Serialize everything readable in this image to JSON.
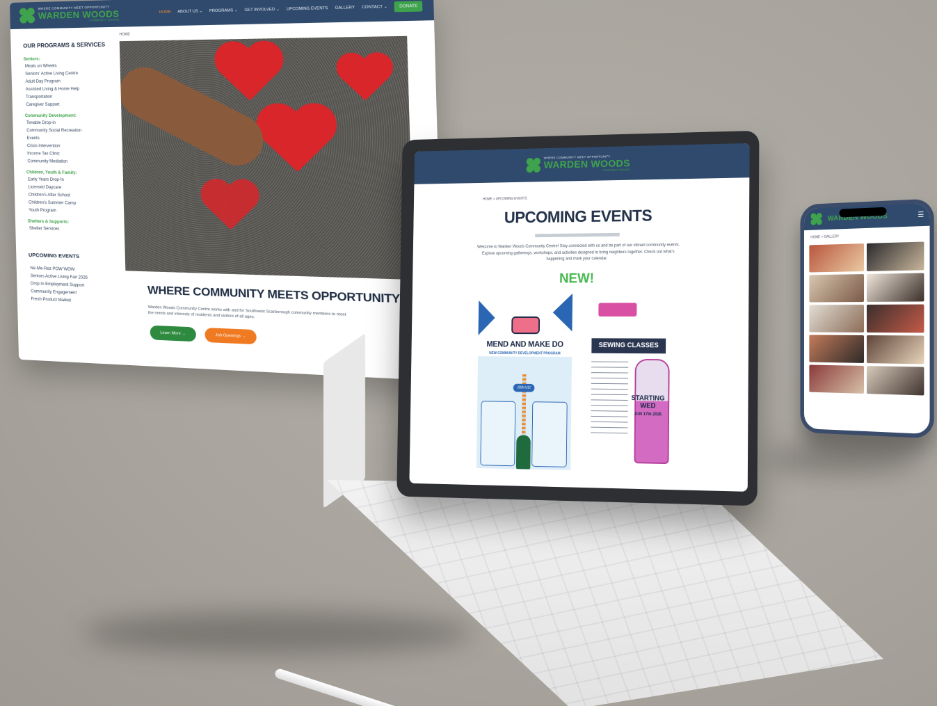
{
  "desktop": {
    "logo": {
      "tagline": "WHERE COMMUNITY MEET OPPORTUNITY",
      "name": "WARDEN WOODS",
      "sub": "COMMUNITY CENTRE"
    },
    "nav": [
      "HOME",
      "ABOUT US ⌄",
      "PROGRAMS ⌄",
      "GET INVOLVED ⌄",
      "UPCOMING EVENTS",
      "GALLERY",
      "CONTACT ⌄"
    ],
    "donate": "DONATE",
    "breadcrumb": "HOME",
    "sidebar": {
      "title": "OUR PROGRAMS & SERVICES",
      "groups": [
        {
          "name": "Seniors:",
          "items": [
            "Meals on Wheels",
            "Seniors' Active Living Centre",
            "Adult Day Program",
            "Assisted Living & Home Help",
            "Transportation",
            "Caregiver Support"
          ]
        },
        {
          "name": "Community Development:",
          "items": [
            "Tenable Drop-in",
            "Community Social Recreation",
            "Events",
            "Crisis Intervention",
            "Income Tax Clinic",
            "Community Mediation"
          ]
        },
        {
          "name": "Children, Youth & Family:",
          "items": [
            "Early Years Drop-In",
            "Licensed Daycare",
            "Children's After School",
            "Children's Summer Camp",
            "Youth Program"
          ]
        },
        {
          "name": "Shelters & Supports:",
          "items": [
            "Shelter Services"
          ]
        }
      ],
      "events_title": "UPCOMING EVENTS",
      "events": [
        "Ne-Me-Rez POW WOW",
        "Seniors Active Living Fair 2026",
        "Drop In Employment Support",
        "Community Engagement",
        "Fresh Product Market"
      ]
    },
    "hero_caption": "Scarborough heart art pavement",
    "heading": "WHERE COMMUNITY MEETS OPPORTUNITY",
    "text": "Warden Woods Community Centre works with and for Southwest Scarborough community members to meet the needs and interests of residents and visitors of all ages.",
    "buttons": [
      "Learn More →",
      "Job Openings →"
    ]
  },
  "tablet": {
    "logo": {
      "tagline": "WHERE COMMUNITY MEET OPPORTUNITY",
      "name": "WARDEN WOODS",
      "sub": "COMMUNITY CENTRE"
    },
    "breadcrumb": "HOME  >  UPCOMING EVENTS",
    "title": "UPCOMING EVENTS",
    "intro": "Welcome to Warden Woods Community Centre! Stay connected with us and be part of our vibrant community events. Explore upcoming gatherings, workshops, and activities designed to bring neighbors together. Check out what's happening and mark your calendar.",
    "new_label": "NEW!",
    "poster1": {
      "title": "MEND AND MAKE DO",
      "subtitle": "NEW COMMUNITY DEVELOPMENT PROGRAM",
      "button": "JOIN US!"
    },
    "poster2": {
      "title": "SEWING CLASSES",
      "starting": "STARTING WED",
      "date": "JUN 17th 2026"
    }
  },
  "phone": {
    "logo": "WARDEN WOODS",
    "breadcrumb": "HOME  >  GALLERY",
    "menu_icon": "hamburger-icon"
  }
}
